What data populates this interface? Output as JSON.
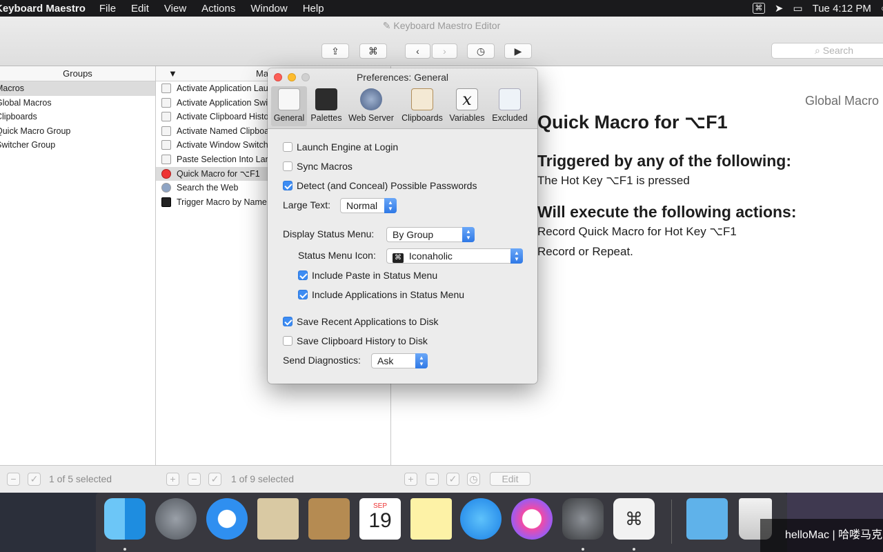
{
  "menubar": {
    "app_name": "Keyboard Maestro",
    "menus": [
      "File",
      "Edit",
      "View",
      "Actions",
      "Window",
      "Help"
    ],
    "clock": "Tue 4:12 PM"
  },
  "window": {
    "title": "Keyboard Maestro Editor",
    "search_placeholder": "Search"
  },
  "groups": {
    "header": "Groups",
    "items": [
      "Macros",
      "Global Macros",
      "Clipboards",
      "Quick Macro Group",
      "Switcher Group"
    ],
    "selected_index": 0
  },
  "macros": {
    "header": "Macros",
    "items": [
      "Activate Application Launcher",
      "Activate Application Switcher",
      "Activate Clipboard History Switcher",
      "Activate Named Clipboard Switcher",
      "Activate Window Switcher",
      "Paste Selection Into Large Text",
      "Quick Macro for ⌥F1",
      "Search the Web",
      "Trigger Macro by Name"
    ],
    "selected_index": 6
  },
  "detail": {
    "group_label": "Global Macro",
    "title": "Quick Macro for ⌥F1",
    "trigger_heading": "Triggered by any of the following:",
    "trigger_text": "The Hot Key ⌥F1 is pressed",
    "actions_heading": "Will execute the following actions:",
    "action_text": "Record Quick Macro for Hot Key ⌥F1",
    "action_text_2": "Record or Repeat."
  },
  "bottom": {
    "groups_status": "1 of 5 selected",
    "macros_status": "1 of 9 selected",
    "edit_label": "Edit"
  },
  "prefs": {
    "title": "Preferences: General",
    "tabs": [
      "General",
      "Palettes",
      "Web Server",
      "Clipboards",
      "Variables",
      "Excluded"
    ],
    "active_tab": "General",
    "launch_engine": "Launch Engine at Login",
    "sync_macros": "Sync Macros",
    "detect_passwords": "Detect (and Conceal) Possible Passwords",
    "large_text_label": "Large Text:",
    "large_text_value": "Normal",
    "display_status_label": "Display Status Menu:",
    "display_status_value": "By Group",
    "status_icon_label": "Status Menu Icon:",
    "status_icon_value": "Iconaholic",
    "include_paste": "Include Paste in Status Menu",
    "include_apps": "Include Applications in Status Menu",
    "save_recent": "Save Recent Applications to Disk",
    "save_clipboard": "Save Clipboard History to Disk",
    "diagnostics_label": "Send Diagnostics:",
    "diagnostics_value": "Ask",
    "checked": {
      "launch_engine": false,
      "sync_macros": false,
      "detect_passwords": true,
      "include_paste": true,
      "include_apps": true,
      "save_recent": true,
      "save_clipboard": false
    }
  },
  "dock": {
    "items": [
      "finder-icon",
      "launchpad-icon",
      "safari-icon",
      "mail-icon",
      "contacts-icon",
      "calendar-icon",
      "notes-icon",
      "messages-icon",
      "itunes-icon",
      "system-preferences-icon",
      "keyboard-maestro-icon",
      "downloads-folder-icon",
      "trash-icon"
    ],
    "calendar_month": "SEP",
    "calendar_day": "19"
  },
  "watermark": "helloMac | 哈喽马克"
}
